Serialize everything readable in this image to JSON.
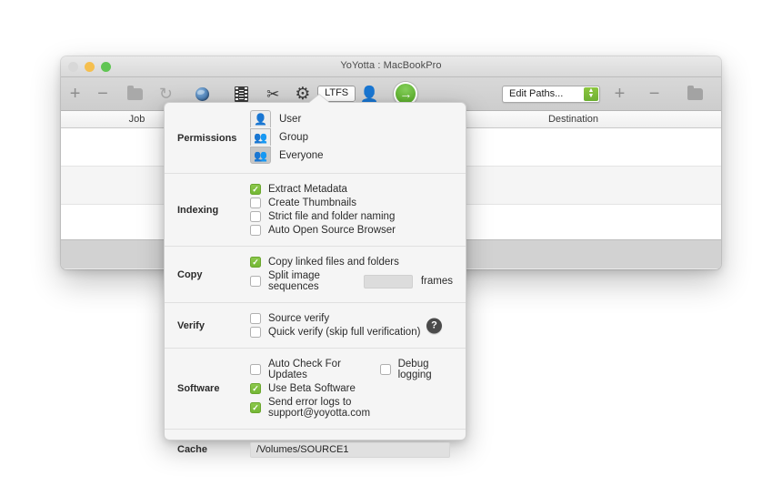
{
  "window": {
    "title": "YoYotta : MacBookPro",
    "traffic_lights": [
      "close",
      "minimize",
      "zoom"
    ]
  },
  "toolbar": {
    "left_items": [
      {
        "name": "add-button",
        "glyph": "+"
      },
      {
        "name": "remove-button",
        "glyph": "−"
      },
      {
        "name": "folder-button",
        "glyph": "folder-icon"
      },
      {
        "name": "refresh-button",
        "glyph": "↻"
      },
      {
        "name": "globe-button",
        "glyph": "globe-icon"
      },
      {
        "name": "film-button",
        "glyph": "film-icon"
      },
      {
        "name": "scissors-button",
        "glyph": "✂"
      },
      {
        "name": "gear-button",
        "glyph": "⚙"
      }
    ],
    "ltfs_badge": "LTFS",
    "person_glyph": "὆4",
    "go_glyph": "→",
    "path_select": {
      "value": "Edit Paths...",
      "up_arrow": "▲",
      "down_arrow": "▼"
    },
    "right_items": [
      {
        "name": "add-path-button",
        "glyph": "+"
      },
      {
        "name": "remove-path-button",
        "glyph": "−"
      },
      {
        "name": "folder-path-button",
        "glyph": "folder-icon"
      }
    ]
  },
  "table": {
    "columns": [
      "Job",
      "",
      "",
      "Destination"
    ],
    "rows": 3
  },
  "popover": {
    "sections": [
      {
        "label": "Permissions",
        "options": [
          {
            "label": "User",
            "selected": false,
            "icon": "user-icon"
          },
          {
            "label": "Group",
            "selected": false,
            "icon": "group-icon"
          },
          {
            "label": "Everyone",
            "selected": true,
            "icon": "everyone-icon"
          }
        ]
      },
      {
        "label": "Indexing",
        "checkboxes": [
          {
            "label": "Extract Metadata",
            "checked": true
          },
          {
            "label": "Create Thumbnails",
            "checked": false
          },
          {
            "label": "Strict file and folder naming",
            "checked": false
          },
          {
            "label": "Auto Open Source Browser",
            "checked": false
          }
        ]
      },
      {
        "label": "Copy",
        "checkboxes": [
          {
            "label": "Copy linked files and folders",
            "checked": true
          },
          {
            "label": "Split image sequences",
            "checked": false
          }
        ],
        "frames_field_value": "",
        "frames_suffix": "frames"
      },
      {
        "label": "Verify",
        "checkboxes": [
          {
            "label": "Source verify",
            "checked": false
          },
          {
            "label": "Quick verify (skip full verification)",
            "checked": false
          }
        ],
        "help_glyph": "?"
      },
      {
        "label": "Software",
        "checkboxes": [
          {
            "label": "Auto Check For Updates",
            "checked": false
          },
          {
            "label": "Debug logging",
            "checked": false
          },
          {
            "label": "Use Beta Software",
            "checked": true
          },
          {
            "label": "Send error logs to support@yoyotta.com",
            "checked": true
          }
        ]
      },
      {
        "label": "Cache",
        "path_value": "/Volumes/SOURCE1"
      }
    ]
  },
  "colors": {
    "accent_green": "#74b735",
    "go_green": "#5fb230",
    "titlebar": "#d9d9d9",
    "popover_bg": "#f5f5f5"
  }
}
